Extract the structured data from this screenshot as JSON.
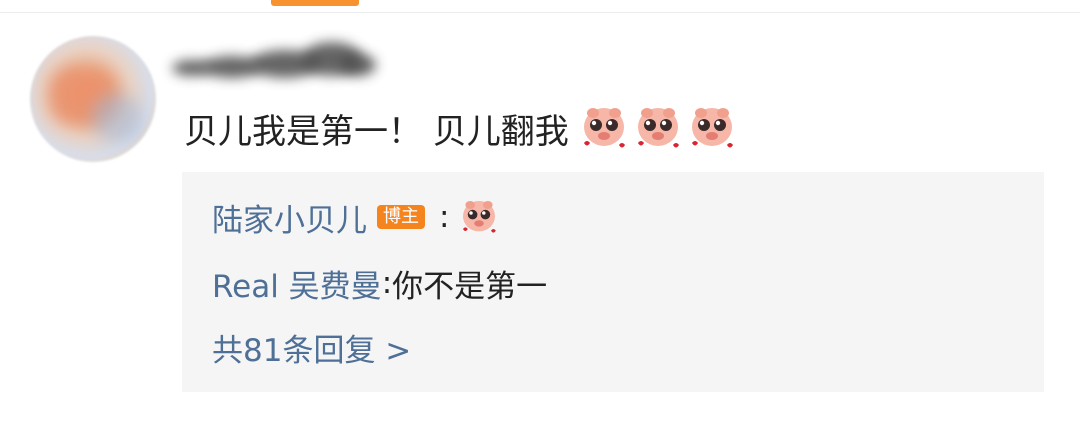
{
  "comment": {
    "text": "贝儿我是第一！ 贝儿翻我",
    "emoji_names": [
      "cute-pig-emoji",
      "cute-pig-emoji",
      "cute-pig-emoji"
    ]
  },
  "replies": [
    {
      "author": "陆家小贝儿",
      "badge": "博主",
      "separator": ":",
      "emoji": "cute-pig-emoji"
    },
    {
      "author": "Real 吴费曼",
      "separator": ":",
      "text": " 你不是第一"
    }
  ],
  "more_replies": {
    "label": "共81条回复 >"
  },
  "colors": {
    "accent": "#f7922f",
    "link": "#4e6f96",
    "reply_bg": "#f5f5f6",
    "badge": "#f5841f"
  }
}
